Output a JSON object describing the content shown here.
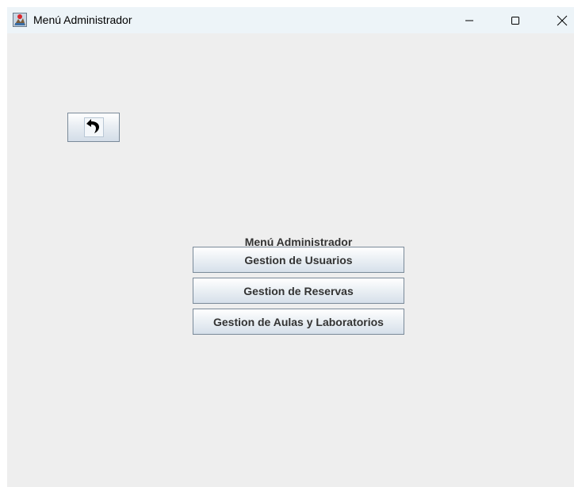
{
  "window": {
    "title": "Menú Administrador",
    "app_icon": "java-icon",
    "controls": {
      "minimize_icon": "minimize-icon",
      "maximize_icon": "maximize-icon",
      "close_icon": "close-icon"
    }
  },
  "back_button": {
    "icon": "back-arrow-icon"
  },
  "menu": {
    "title": "Menú Administrador",
    "buttons": [
      {
        "label": "Gestion de Usuarios"
      },
      {
        "label": "Gestion de Reservas"
      },
      {
        "label": "Gestion de Aulas y Laboratorios"
      }
    ]
  },
  "colors": {
    "title_bar": "#edf4f8",
    "background": "#eeeeee",
    "button_border": "#7a8a99",
    "text": "#333333"
  }
}
